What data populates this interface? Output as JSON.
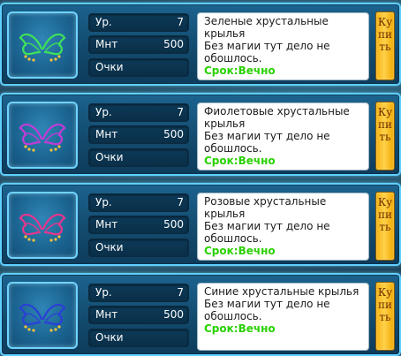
{
  "buy_label": "Купить",
  "colors": {
    "card_border": "#5fd0ff",
    "term_text": "#2ad100",
    "buy_button": "#f5b210"
  },
  "items": [
    {
      "stats": [
        {
          "label": "Ур.",
          "value": "7"
        },
        {
          "label": "Мнт",
          "value": "500"
        },
        {
          "label": "Очки",
          "value": ""
        }
      ],
      "name": "Зеленые хрустальные крылья",
      "description": "Без магии тут дело не обошлось.",
      "term": "Срок:Вечно",
      "icon": "green-crystal-wings-icon",
      "wing_color": "#3fe25a"
    },
    {
      "stats": [
        {
          "label": "Ур.",
          "value": "7"
        },
        {
          "label": "Мнт",
          "value": "500"
        },
        {
          "label": "Очки",
          "value": ""
        }
      ],
      "name": "Фиолетовые хрустальные крылья",
      "description": "Без магии тут дело не обошлось.",
      "term": "Срок:Вечно",
      "icon": "purple-crystal-wings-icon",
      "wing_color": "#c23bd8"
    },
    {
      "stats": [
        {
          "label": "Ур.",
          "value": "7"
        },
        {
          "label": "Мнт",
          "value": "500"
        },
        {
          "label": "Очки",
          "value": ""
        }
      ],
      "name": "Розовые хрустальные крылья",
      "description": "Без магии тут дело не обошлось.",
      "term": "Срок:Вечно",
      "icon": "pink-crystal-wings-icon",
      "wing_color": "#e8358f"
    },
    {
      "stats": [
        {
          "label": "Ур.",
          "value": "7"
        },
        {
          "label": "Мнт",
          "value": "500"
        },
        {
          "label": "Очки",
          "value": ""
        }
      ],
      "name": "Синие хрустальные крылья",
      "description": "Без магии тут дело не обошлось.",
      "term": "Срок:Вечно",
      "icon": "blue-crystal-wings-icon",
      "wing_color": "#2a3fd6"
    }
  ]
}
